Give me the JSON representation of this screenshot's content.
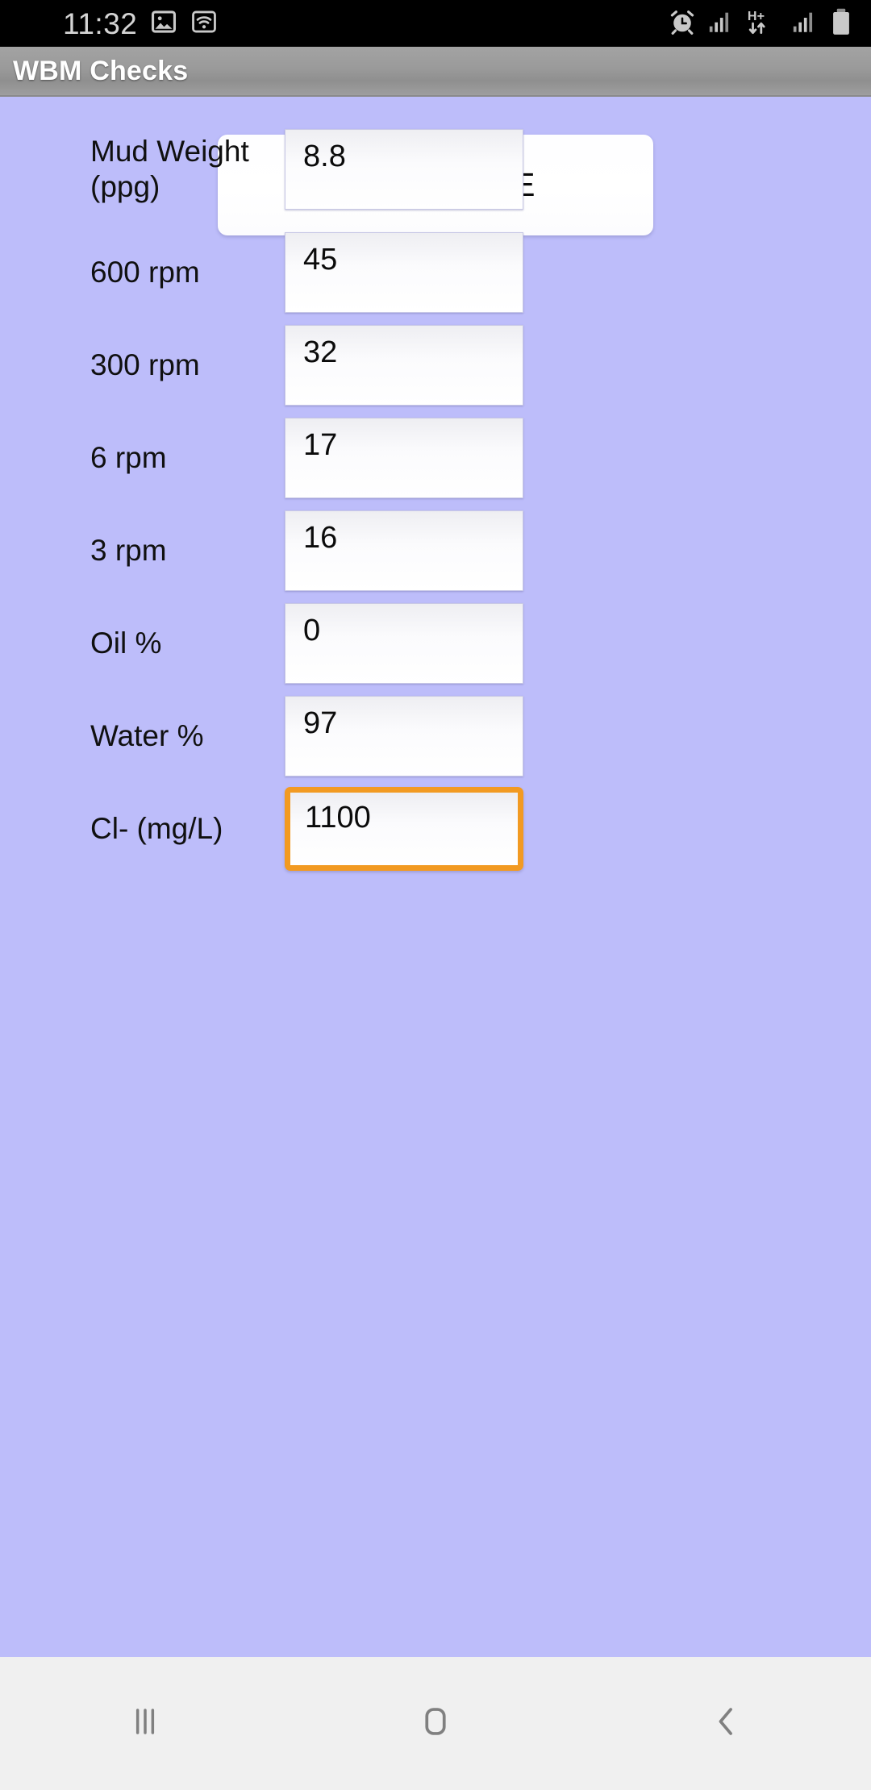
{
  "status_bar": {
    "time": "11:32",
    "left_icons": [
      "photo-icon",
      "wifi-icon"
    ],
    "right_icons": [
      "alarm-icon",
      "signal-bars-icon",
      "hplus-data-icon",
      "signal-bars-2-icon",
      "battery-icon"
    ],
    "network_label": "H+",
    "background_color": "#000000",
    "icon_color": "#c9c9c9"
  },
  "app_bar": {
    "title": "WBM Checks",
    "background_color": "#9a9a9a",
    "text_color": "#ffffff"
  },
  "theme": {
    "page_background": "#BDBDFA",
    "focus_accent": "#F29A22",
    "field_background": "#ffffff",
    "text_color": "#101010"
  },
  "form": {
    "fields": [
      {
        "label": "Mud Weight (ppg)",
        "value": "8.8",
        "name": "mud-weight",
        "focused": false,
        "tall": true
      },
      {
        "label": "600 rpm",
        "value": "45",
        "name": "600-rpm",
        "focused": false,
        "tall": false
      },
      {
        "label": "300 rpm",
        "value": "32",
        "name": "300-rpm",
        "focused": false,
        "tall": false
      },
      {
        "label": "6 rpm",
        "value": "17",
        "name": "6-rpm",
        "focused": false,
        "tall": false
      },
      {
        "label": "3 rpm",
        "value": "16",
        "name": "3-rpm",
        "focused": false,
        "tall": false
      },
      {
        "label": "Oil %",
        "value": "0",
        "name": "oil-percent",
        "focused": false,
        "tall": false
      },
      {
        "label": "Water %",
        "value": "97",
        "name": "water-percent",
        "focused": false,
        "tall": false
      },
      {
        "label": "Cl- (mg/L)",
        "value": "1100",
        "name": "chloride",
        "focused": true,
        "tall": false
      }
    ]
  },
  "actions": {
    "calculate_label": "CALCULATE"
  },
  "nav_bar": {
    "buttons": [
      {
        "name": "recents-button",
        "icon": "recents-icon"
      },
      {
        "name": "home-button",
        "icon": "home-icon"
      },
      {
        "name": "back-button",
        "icon": "back-chevron-icon"
      }
    ],
    "background_color": "#f0f0f0",
    "icon_color": "#808080"
  }
}
